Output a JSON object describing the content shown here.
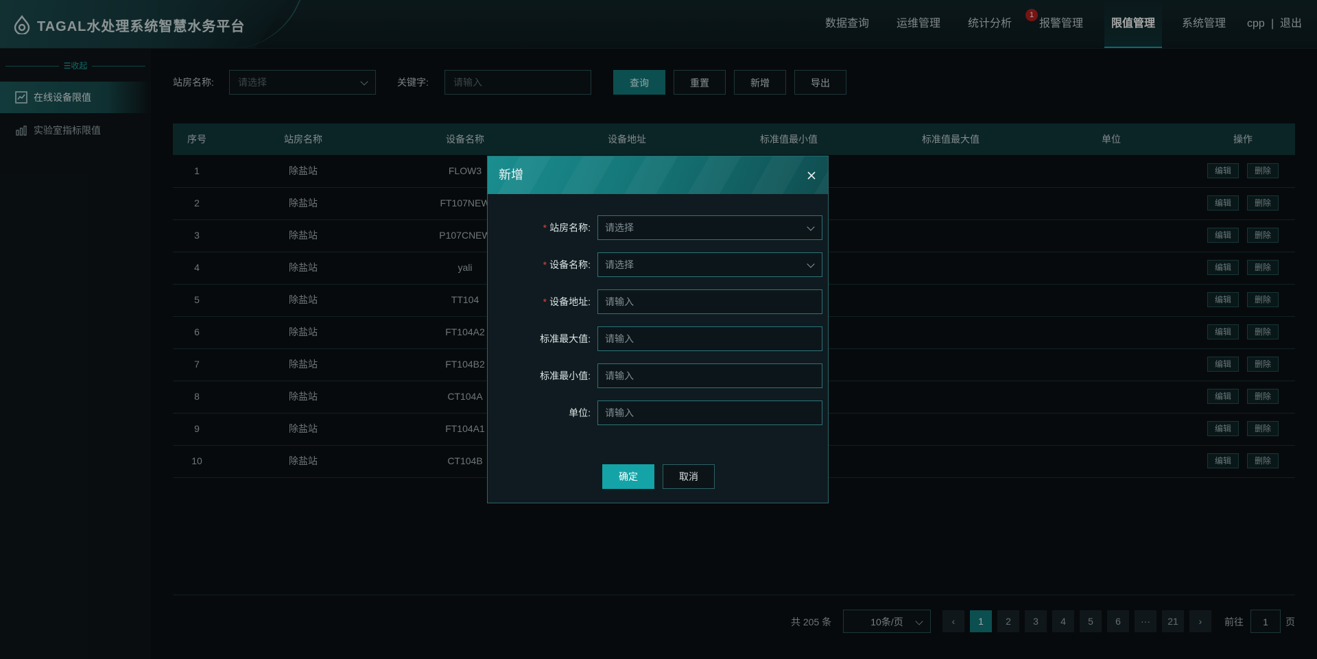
{
  "header": {
    "title": "TAGAL水处理系统智慧水务平台",
    "nav": [
      "数据查询",
      "运维管理",
      "统计分析",
      "报警管理",
      "限值管理",
      "系统管理"
    ],
    "active_nav": "限值管理",
    "alarm_badge": "1",
    "user": "cpp",
    "separator": "|",
    "logout": "退出"
  },
  "sidebar": {
    "collapse_label": "☰收起",
    "items": [
      {
        "label": "在线设备限值",
        "icon": "gauge-chart-icon",
        "active": true
      },
      {
        "label": "实验室指标限值",
        "icon": "bar-chart-icon",
        "active": false
      }
    ]
  },
  "filters": {
    "station_label": "站房名称:",
    "station_placeholder": "请选择",
    "keyword_label": "关键字:",
    "keyword_placeholder": "请输入",
    "buttons": [
      "查询",
      "重置",
      "新增",
      "导出"
    ]
  },
  "table": {
    "columns": [
      "序号",
      "站房名称",
      "设备名称",
      "设备地址",
      "标准值最小值",
      "标准值最大值",
      "单位",
      "操作"
    ],
    "rows": [
      {
        "no": "1",
        "station": "除盐站",
        "device": "FLOW3"
      },
      {
        "no": "2",
        "station": "除盐站",
        "device": "FT107NEW"
      },
      {
        "no": "3",
        "station": "除盐站",
        "device": "P107CNEW"
      },
      {
        "no": "4",
        "station": "除盐站",
        "device": "yali"
      },
      {
        "no": "5",
        "station": "除盐站",
        "device": "TT104"
      },
      {
        "no": "6",
        "station": "除盐站",
        "device": "FT104A2"
      },
      {
        "no": "7",
        "station": "除盐站",
        "device": "FT104B2"
      },
      {
        "no": "8",
        "station": "除盐站",
        "device": "CT104A"
      },
      {
        "no": "9",
        "station": "除盐站",
        "device": "FT104A1"
      },
      {
        "no": "10",
        "station": "除盐站",
        "device": "CT104B"
      }
    ],
    "edit_label": "编辑",
    "delete_label": "删除"
  },
  "pagination": {
    "total": "共 205 条",
    "page_size": "10条/页",
    "pages": [
      "1",
      "2",
      "3",
      "4",
      "5",
      "6",
      "···",
      "21"
    ],
    "current": "1",
    "goto_label": "前往",
    "goto_value": "1",
    "page_suffix": "页",
    "prev": "‹",
    "next": "›"
  },
  "dialog": {
    "title": "新增",
    "fields": [
      {
        "label": "站房名称:",
        "required": true,
        "placeholder": "请选择",
        "type": "select"
      },
      {
        "label": "设备名称:",
        "required": true,
        "placeholder": "请选择",
        "type": "select"
      },
      {
        "label": "设备地址:",
        "required": true,
        "placeholder": "请输入",
        "type": "input"
      },
      {
        "label": "标准最大值:",
        "required": false,
        "placeholder": "请输入",
        "type": "input"
      },
      {
        "label": "标准最小值:",
        "required": false,
        "placeholder": "请输入",
        "type": "input"
      },
      {
        "label": "单位:",
        "required": false,
        "placeholder": "请输入",
        "type": "input"
      }
    ],
    "required_mark": "*",
    "confirm": "确定",
    "cancel": "取消"
  },
  "colors": {
    "accent": "#1aa1a1",
    "primary_button": "#137a7c",
    "required": "#e0453d",
    "badge": "#b51f1f"
  }
}
